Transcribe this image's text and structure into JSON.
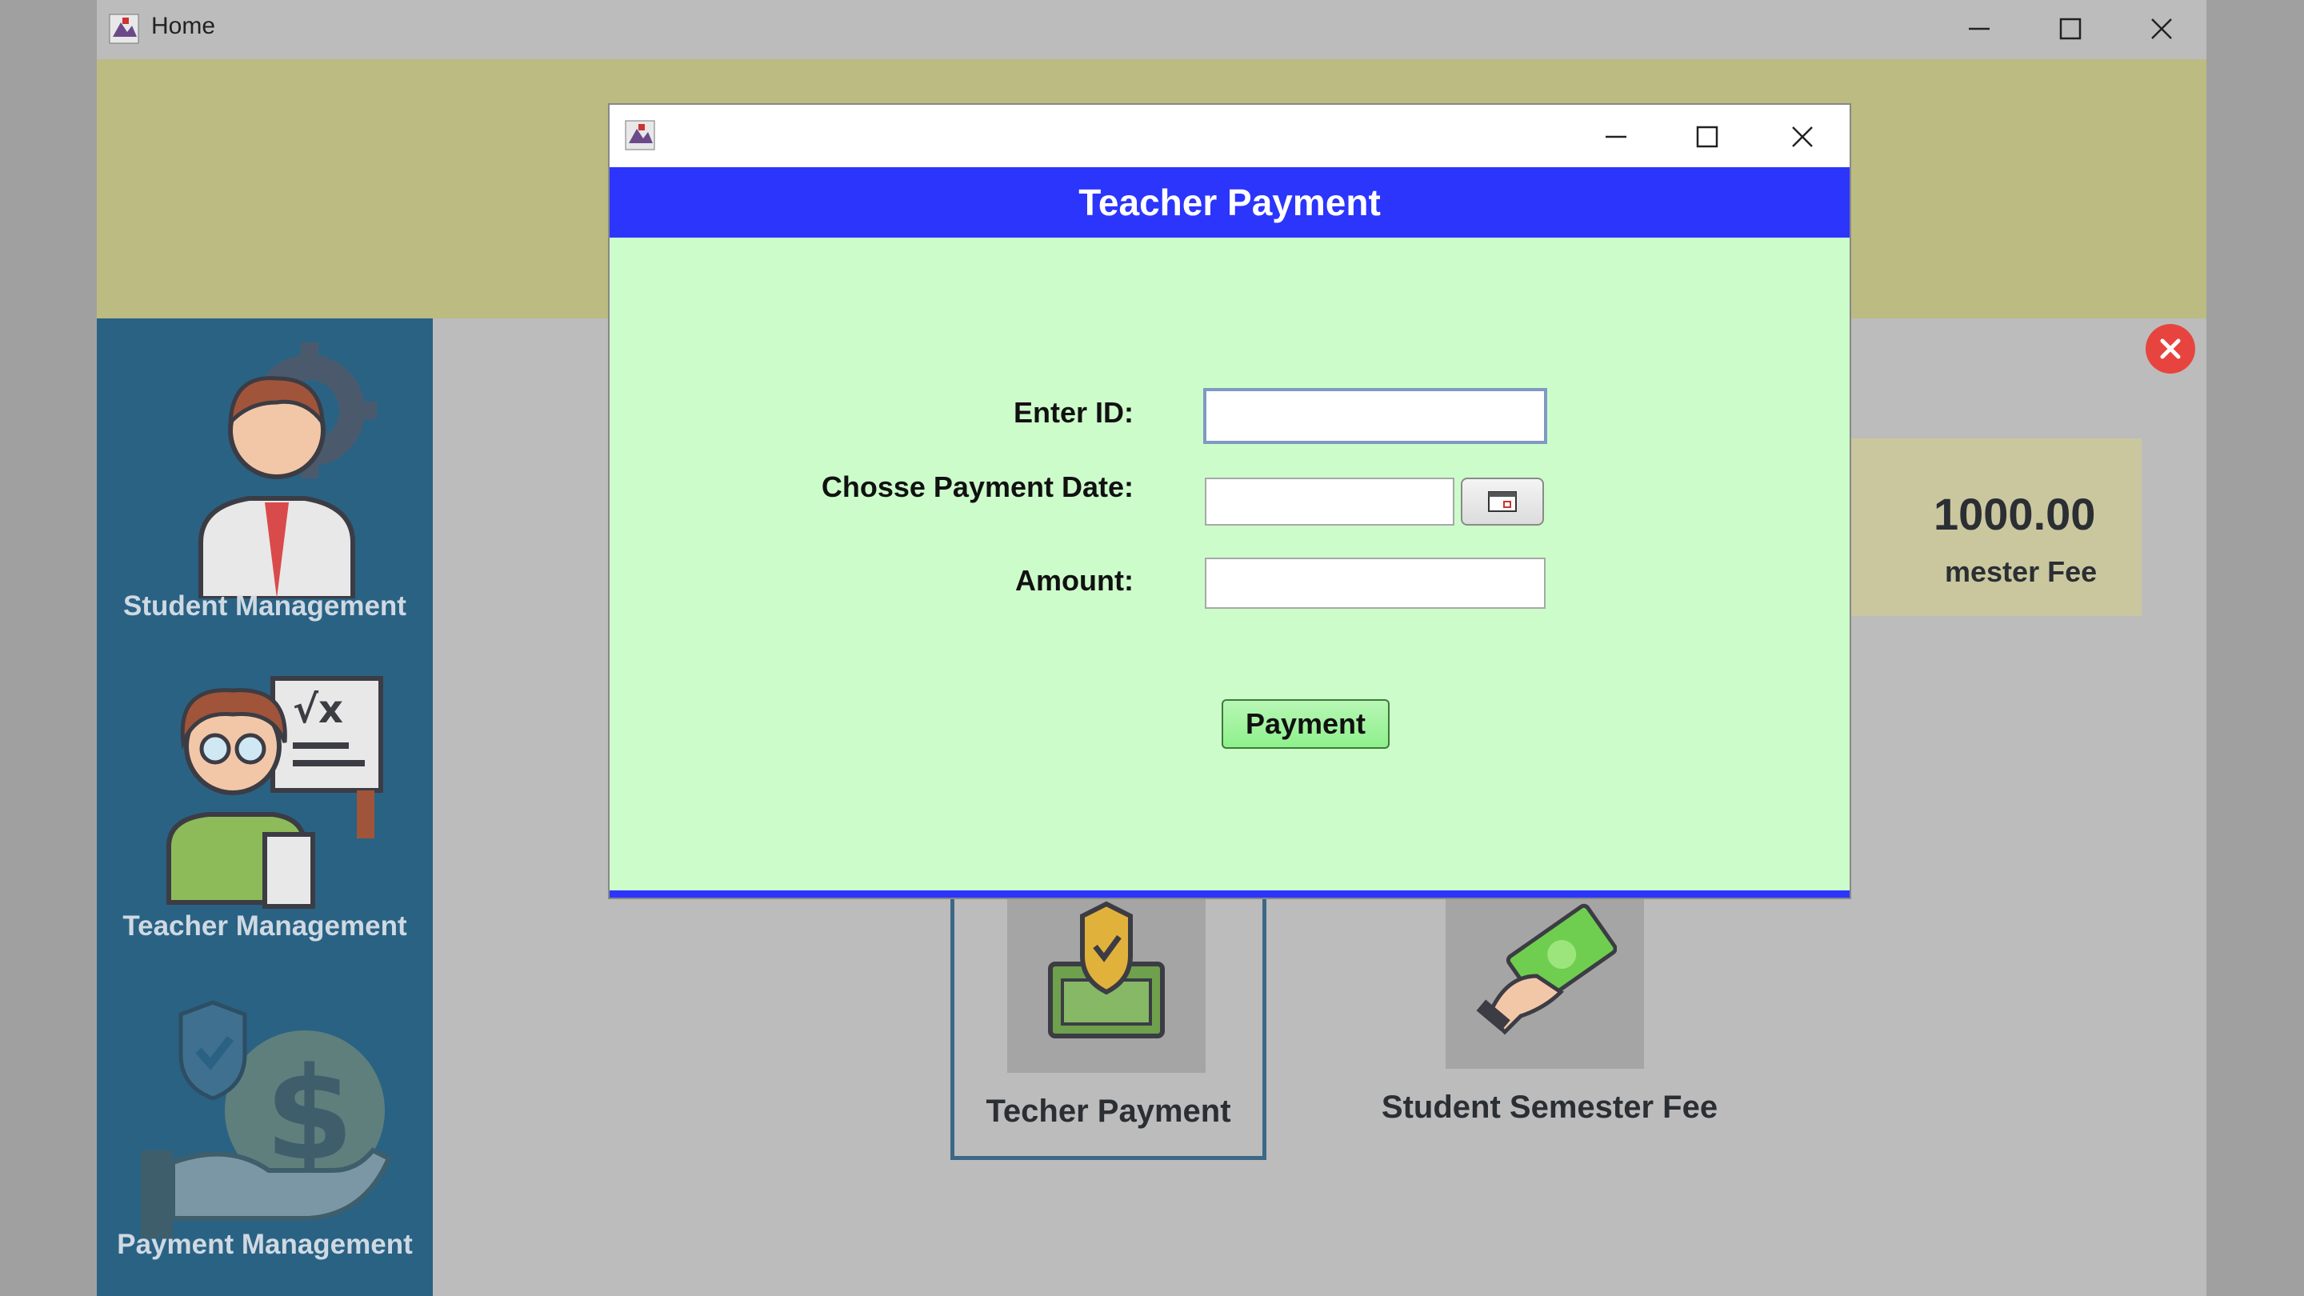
{
  "window": {
    "title": "Home"
  },
  "sidebar": {
    "items": [
      {
        "label": "Student Management",
        "icon": "student-management-icon"
      },
      {
        "label": "Teacher Management",
        "icon": "teacher-management-icon"
      },
      {
        "label": "Payment Management",
        "icon": "payment-management-icon"
      }
    ]
  },
  "summary_card": {
    "value": "1000.00",
    "label": "mester Fee"
  },
  "tiles": [
    {
      "label": "Techer Payment",
      "icon": "shield-money-icon"
    },
    {
      "label": "Student Semester Fee",
      "icon": "hand-cash-icon"
    }
  ],
  "dialog": {
    "header": "Teacher Payment",
    "id_label": "Enter ID:",
    "date_label": "Chosse Payment Date:",
    "amount_label": "Amount:",
    "id_value": "",
    "date_value": "",
    "amount_value": "",
    "submit_label": "Payment"
  },
  "colors": {
    "banner": "#bcbb82",
    "sidebar": "#2a6284",
    "dialog_header": "#2b35fb",
    "dialog_body": "#cdfccb",
    "payment_button": "#9ef39b"
  }
}
